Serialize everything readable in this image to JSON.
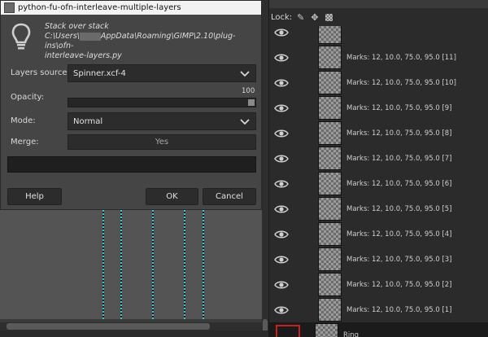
{
  "dialog": {
    "title": "python-fu-ofn-interleave-multiple-layers",
    "info_line1": "Stack over stack",
    "info_path_prefix": "C:\\Users\\",
    "info_path_suffix": "AppData\\Roaming\\GIMP\\2.10\\plug-ins\\ofn-",
    "info_line3": "interleave-layers.py",
    "layers_source_label": "Layers source:",
    "layers_source_value": "Spinner.xcf-4",
    "opacity_label": "Opacity:",
    "opacity_value": "100",
    "mode_label": "Mode:",
    "mode_value": "Normal",
    "merge_label": "Merge:",
    "merge_value": "Yes",
    "help_label": "Help",
    "ok_label": "OK",
    "cancel_label": "Cancel"
  },
  "layers_panel": {
    "lock_label": "Lock:",
    "layers": [
      {
        "name": "",
        "visible": true
      },
      {
        "name": "Marks: 12, 10.0, 75.0, 95.0 [11]",
        "visible": true
      },
      {
        "name": "Marks: 12, 10.0, 75.0, 95.0 [10]",
        "visible": true
      },
      {
        "name": "Marks: 12, 10.0, 75.0, 95.0 [9]",
        "visible": true
      },
      {
        "name": "Marks: 12, 10.0, 75.0, 95.0 [8]",
        "visible": true
      },
      {
        "name": "Marks: 12, 10.0, 75.0, 95.0 [7]",
        "visible": true
      },
      {
        "name": "Marks: 12, 10.0, 75.0, 95.0 [6]",
        "visible": true
      },
      {
        "name": "Marks: 12, 10.0, 75.0, 95.0 [5]",
        "visible": true
      },
      {
        "name": "Marks: 12, 10.0, 75.0, 95.0 [4]",
        "visible": true
      },
      {
        "name": "Marks: 12, 10.0, 75.0, 95.0 [3]",
        "visible": true
      },
      {
        "name": "Marks: 12, 10.0, 75.0, 95.0 [2]",
        "visible": true
      },
      {
        "name": "Marks: 12, 10.0, 75.0, 95.0 [1]",
        "visible": true
      },
      {
        "name": "Ring",
        "visible": false,
        "selected": true
      }
    ]
  },
  "colors": {
    "guide": "#38c8d8",
    "selection_outline": "#cc1f1f"
  }
}
